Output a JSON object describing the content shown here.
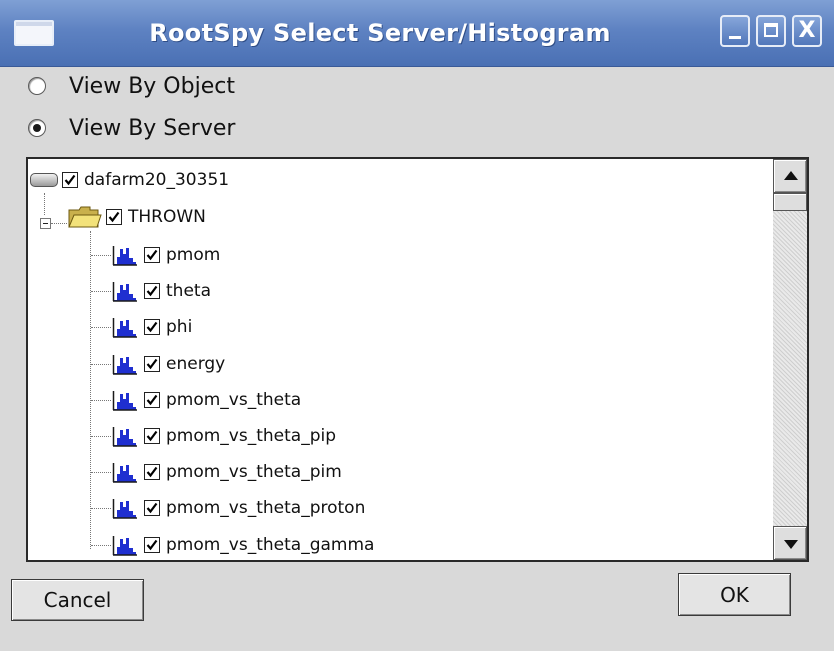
{
  "window": {
    "title": "RootSpy Select Server/Histogram",
    "controls": {
      "minimize": "_",
      "maximize": "",
      "close": "X"
    }
  },
  "view_options": [
    {
      "label": "View By Object",
      "checked": false
    },
    {
      "label": "View By Server",
      "checked": true
    }
  ],
  "tree": {
    "server": {
      "label": "dafarm20_30351",
      "checked": true,
      "icon": "server-icon"
    },
    "folder": {
      "label": "THROWN",
      "checked": true,
      "icon": "folder-icon",
      "expanded": true
    },
    "histograms": [
      {
        "label": "pmom",
        "checked": true
      },
      {
        "label": "theta",
        "checked": true
      },
      {
        "label": "phi",
        "checked": true
      },
      {
        "label": "energy",
        "checked": true
      },
      {
        "label": "pmom_vs_theta",
        "checked": true
      },
      {
        "label": "pmom_vs_theta_pip",
        "checked": true
      },
      {
        "label": "pmom_vs_theta_pim",
        "checked": true
      },
      {
        "label": "pmom_vs_theta_proton",
        "checked": true
      },
      {
        "label": "pmom_vs_theta_gamma",
        "checked": true
      }
    ]
  },
  "buttons": {
    "cancel": "Cancel",
    "ok": "OK"
  },
  "colors": {
    "titlebar": "#5e82c2",
    "window_bg": "#d9d9d9",
    "histogram_icon": "#1f2fd0",
    "folder": "#e8d060"
  }
}
